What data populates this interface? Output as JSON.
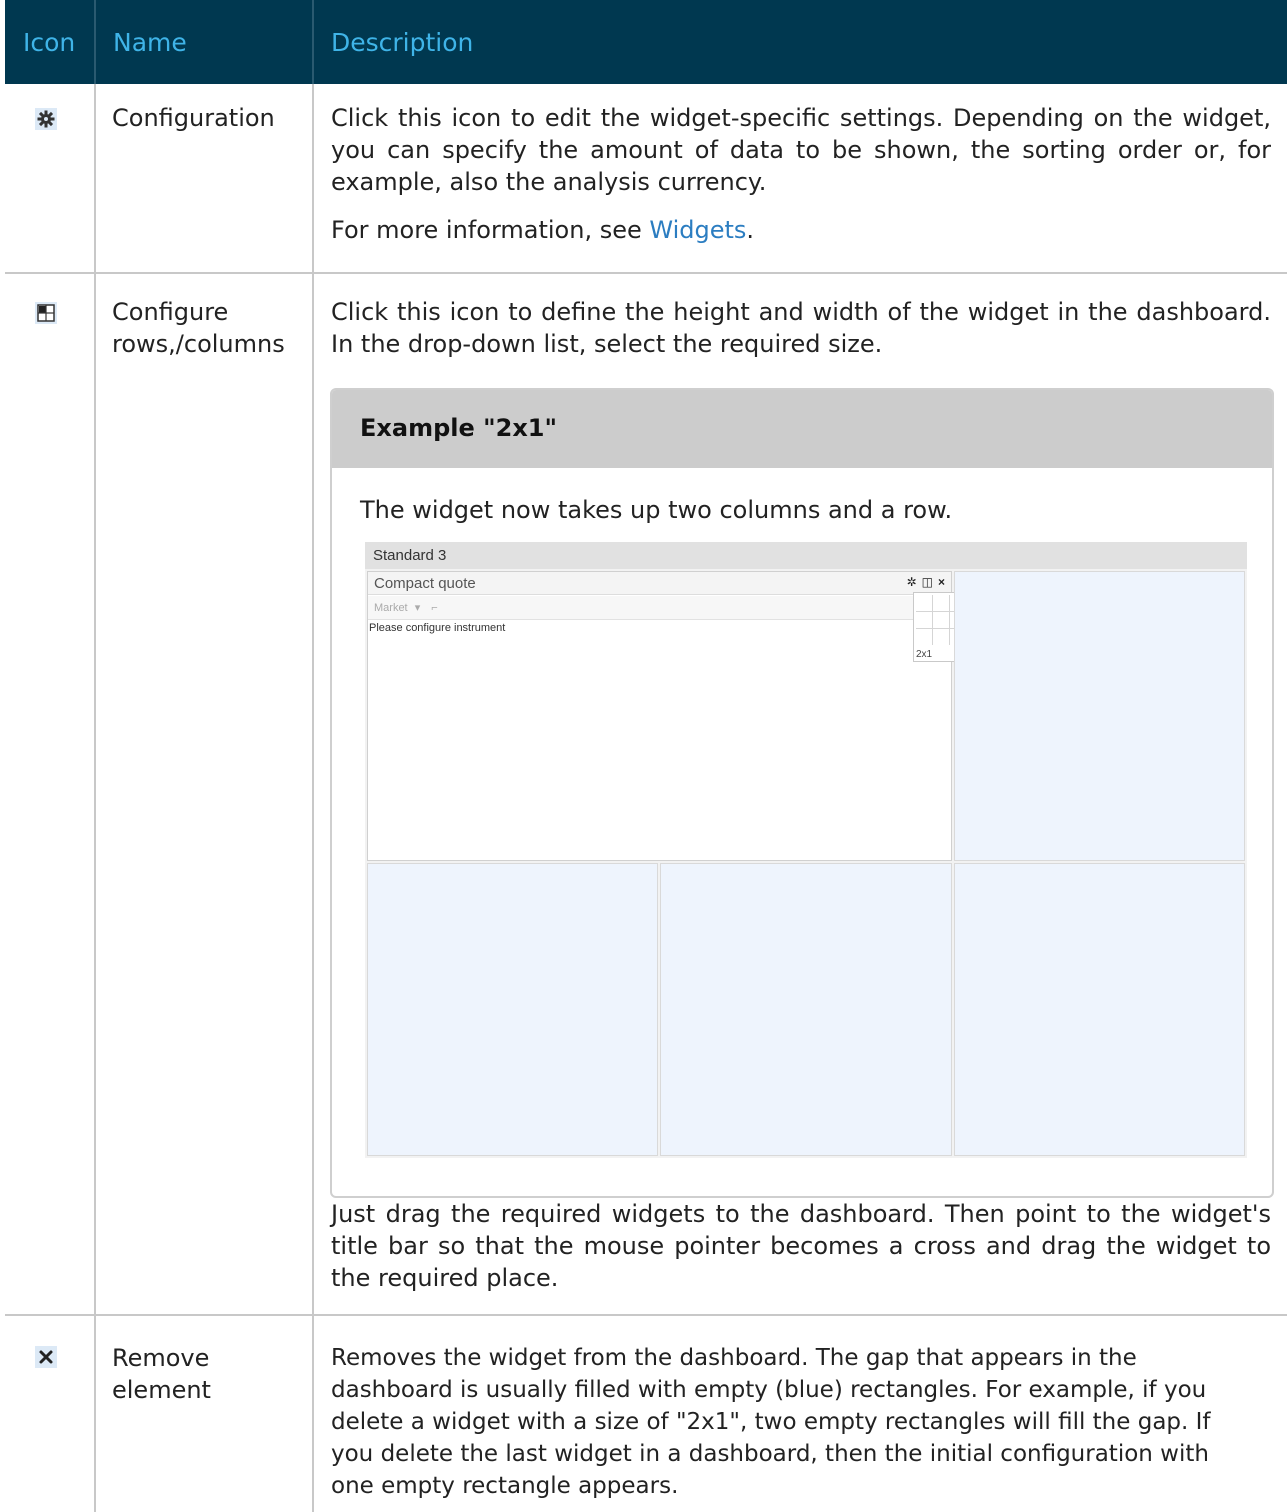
{
  "header": {
    "icon": "Icon",
    "name": "Name",
    "description": "Description"
  },
  "rows": [
    {
      "icon": "gear-icon",
      "name": "Configuration",
      "desc1": "Click this icon to edit the widget-specific settings. Depending on the widget, you can specify the amount of data to be shown, the sorting order or, for example, also the analysis currency.",
      "desc2_prefix": "For more information, see ",
      "desc2_link": "Widgets",
      "desc2_suffix": "."
    },
    {
      "icon": "grid-size-icon",
      "name_line1": "Configure",
      "name_line2": "rows,/columns",
      "desc1": "Click this icon to define the height and width of the widget in the dashboard. In the drop-down list, select the required size.",
      "example_title": "Example \"2x1\"",
      "example_text": "The widget now takes up two columns and a row.",
      "desc2": "Just drag the required widgets to the dashboard. Then point to the widget's title bar so that the mouse pointer becomes a cross and drag the widget to the required place."
    },
    {
      "icon": "close-icon",
      "name_line1": "Remove",
      "name_line2": "element",
      "desc_lines": [
        "Removes the widget from the dashboard. The gap that appears in the",
        "dashboard is usually filled with empty (blue) rectangles. For example, if you",
        "delete a widget with a size of \"2x1\", two empty rectangles will fill the gap. If",
        "you delete the last widget in a dashboard, then the initial configuration with",
        "one empty rectangle appears."
      ]
    }
  ],
  "screenshot": {
    "dashboard_title": "Standard 3",
    "widget_title": "Compact quote",
    "toolbar_market": "Market",
    "toolbar_arrow": "⌐",
    "message": "Please configure instrument",
    "size_label": "2x1",
    "tool_gear": "✲",
    "tool_grid": "◫",
    "tool_close": "×"
  }
}
